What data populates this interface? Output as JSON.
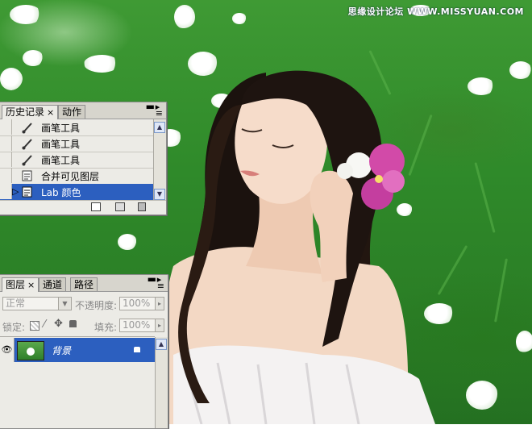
{
  "watermark": "思缘设计论坛 WWW.MISSYUAN.COM",
  "history_panel": {
    "tabs": [
      {
        "label": "历史记录",
        "active": true,
        "close": "×"
      },
      {
        "label": "动作",
        "active": false
      }
    ],
    "items": [
      {
        "label": "画笔工具",
        "icon": "brush-icon",
        "selected": false
      },
      {
        "label": "画笔工具",
        "icon": "brush-icon",
        "selected": false
      },
      {
        "label": "画笔工具",
        "icon": "brush-icon",
        "selected": false
      },
      {
        "label": "合并可见图层",
        "icon": "history-state-icon",
        "selected": false
      },
      {
        "label": "Lab 颜色",
        "icon": "history-state-icon",
        "selected": true
      }
    ]
  },
  "layers_panel": {
    "tabs": [
      {
        "label": "图层",
        "active": true,
        "close": "×"
      },
      {
        "label": "通道",
        "active": false
      },
      {
        "label": "路径",
        "active": false
      }
    ],
    "blend_mode": "正常",
    "opacity_label": "不透明度:",
    "opacity_value": "100%",
    "lock_label": "锁定:",
    "fill_label": "填充:",
    "fill_value": "100%",
    "layers": [
      {
        "name": "背景",
        "visible": true,
        "locked": true,
        "selected": true
      }
    ]
  },
  "colors": {
    "selection": "#2c5fbf",
    "panel_bg": "#ecebe6",
    "grass": "#2f8a2a"
  }
}
